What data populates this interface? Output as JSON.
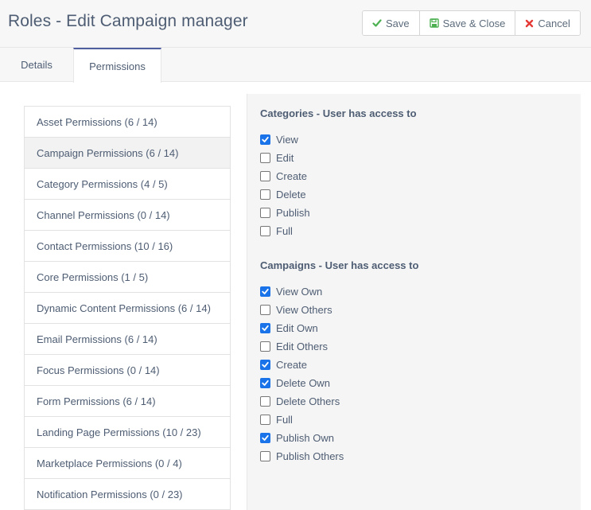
{
  "header": {
    "title": "Roles - Edit Campaign manager",
    "buttons": {
      "save": "Save",
      "save_close": "Save & Close",
      "cancel": "Cancel"
    },
    "colors": {
      "save_icon": "#4caf50",
      "save_close_icon": "#4caf50",
      "cancel_icon": "#e53935"
    }
  },
  "tabs": [
    {
      "label": "Details",
      "active": false
    },
    {
      "label": "Permissions",
      "active": true
    }
  ],
  "permission_groups": [
    {
      "label": "Asset Permissions (6 / 14)",
      "active": false
    },
    {
      "label": "Campaign Permissions (6 / 14)",
      "active": true
    },
    {
      "label": "Category Permissions (4 / 5)",
      "active": false
    },
    {
      "label": "Channel Permissions (0 / 14)",
      "active": false
    },
    {
      "label": "Contact Permissions (10 / 16)",
      "active": false
    },
    {
      "label": "Core Permissions (1 / 5)",
      "active": false
    },
    {
      "label": "Dynamic Content Permissions (6 / 14)",
      "active": false
    },
    {
      "label": "Email Permissions (6 / 14)",
      "active": false
    },
    {
      "label": "Focus Permissions (0 / 14)",
      "active": false
    },
    {
      "label": "Form Permissions (6 / 14)",
      "active": false
    },
    {
      "label": "Landing Page Permissions (10 / 23)",
      "active": false
    },
    {
      "label": "Marketplace Permissions (0 / 4)",
      "active": false
    },
    {
      "label": "Notification Permissions (0 / 23)",
      "active": false
    }
  ],
  "categories": {
    "title": "Categories - User has access to",
    "options": [
      {
        "label": "View",
        "checked": true
      },
      {
        "label": "Edit",
        "checked": false
      },
      {
        "label": "Create",
        "checked": false
      },
      {
        "label": "Delete",
        "checked": false
      },
      {
        "label": "Publish",
        "checked": false
      },
      {
        "label": "Full",
        "checked": false
      }
    ]
  },
  "campaigns": {
    "title": "Campaigns - User has access to",
    "options": [
      {
        "label": "View Own",
        "checked": true
      },
      {
        "label": "View Others",
        "checked": false
      },
      {
        "label": "Edit Own",
        "checked": true
      },
      {
        "label": "Edit Others",
        "checked": false
      },
      {
        "label": "Create",
        "checked": true
      },
      {
        "label": "Delete Own",
        "checked": true
      },
      {
        "label": "Delete Others",
        "checked": false
      },
      {
        "label": "Full",
        "checked": false
      },
      {
        "label": "Publish Own",
        "checked": true
      },
      {
        "label": "Publish Others",
        "checked": false
      }
    ]
  }
}
